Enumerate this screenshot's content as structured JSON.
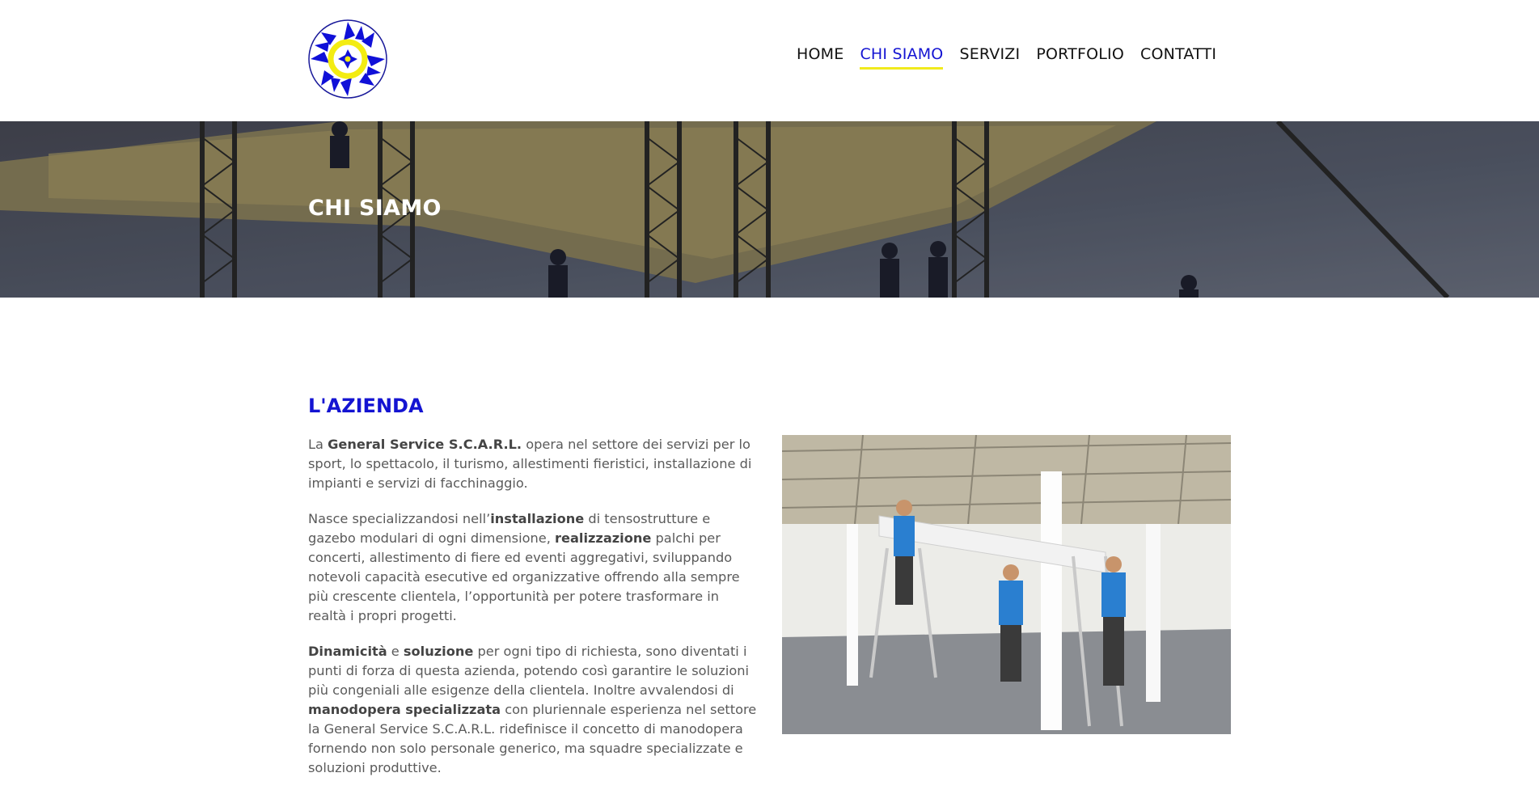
{
  "header": {
    "logo_alt": "General Service S.C.A.R.L. logo",
    "nav": [
      {
        "label": "HOME",
        "active": false
      },
      {
        "label": "CHI SIAMO",
        "active": true
      },
      {
        "label": "SERVIZI",
        "active": false
      },
      {
        "label": "PORTFOLIO",
        "active": false
      },
      {
        "label": "CONTATTI",
        "active": false
      }
    ]
  },
  "banner": {
    "title": "CHI SIAMO"
  },
  "section": {
    "title": "L'AZIENDA",
    "p1": {
      "a": "La ",
      "b": "General Service S.C.A.R.L.",
      "c": " opera nel settore dei servizi per lo sport, lo spettacolo, il turismo, allestimenti fieristici, installazione di impianti e servizi di facchinaggio."
    },
    "p2": {
      "a": "Nasce specializzandosi nell’",
      "b": "installazione",
      "c": " di tensostrutture e gazebo modulari di ogni dimensione, ",
      "d": "realizzazione",
      "e": " palchi per concerti, allestimento di fiere ed eventi aggregativi, sviluppando notevoli capacità esecutive ed organizzative offrendo alla sempre più crescente clientela, l’opportunità per potere trasformare in realtà i propri progetti."
    },
    "p3": {
      "a": "Dinamicità",
      "b": " e ",
      "c": "soluzione",
      "d": " per ogni tipo di richiesta, sono diventati i punti di forza di questa azienda, potendo così garantire le soluzioni più congeniali alle esigenze della clientela. Inoltre avvalendosi di ",
      "e": "manodopera specializzata",
      "f": " con pluriennale esperienza nel settore la General Service S.C.A.R.L. ridefinisce il concetto di manodopera fornendo non solo personale generico, ma squadre specializzate e soluzioni produttive."
    }
  },
  "colors": {
    "accent": "#1414d2",
    "underline": "#f1ea1d"
  }
}
